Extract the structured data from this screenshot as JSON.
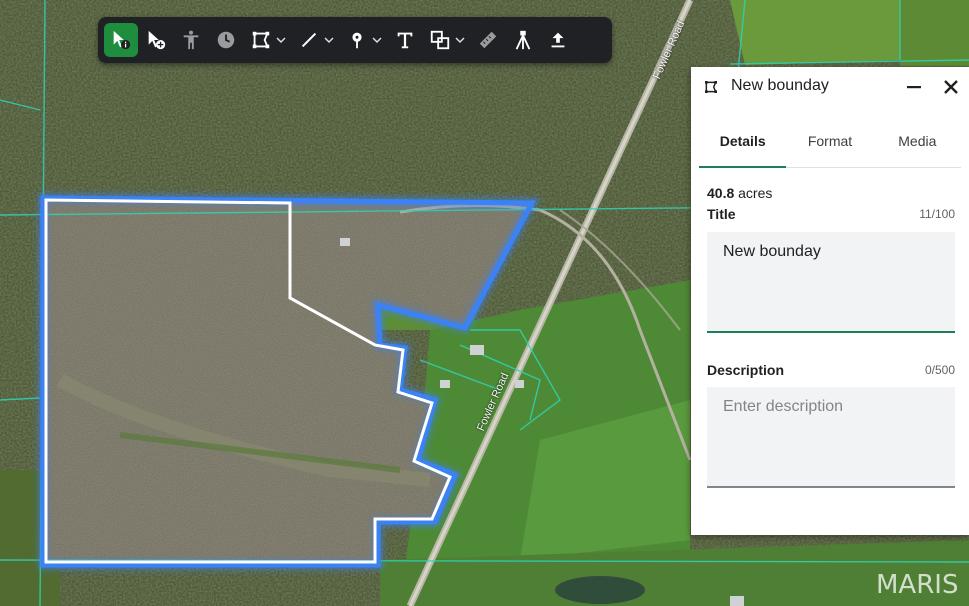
{
  "map": {
    "road_labels": [
      "Fowler Road",
      "Fowler Road"
    ],
    "watermark": "MARIS",
    "colors": {
      "boundary_outline": "#3b82f6",
      "boundary_inner": "#ffffff",
      "parcel_lines": "#2fd3b4"
    }
  },
  "toolbar": {
    "tools": [
      {
        "name": "select-tool",
        "icon": "cursor-info-icon",
        "active": true
      },
      {
        "name": "add-point-tool",
        "icon": "cursor-add-icon"
      },
      {
        "name": "street-view-tool",
        "icon": "pegman-icon"
      },
      {
        "name": "history-tool",
        "icon": "clock-icon"
      },
      {
        "name": "polygon-tool",
        "icon": "polygon-icon",
        "has_dropdown": true
      },
      {
        "name": "line-tool",
        "icon": "line-icon",
        "has_dropdown": true
      },
      {
        "name": "pin-tool",
        "icon": "pin-icon",
        "has_dropdown": true
      },
      {
        "name": "text-tool",
        "icon": "text-icon"
      },
      {
        "name": "shapes-tool",
        "icon": "shapes-icon",
        "has_dropdown": true
      },
      {
        "name": "measure-tool",
        "icon": "ruler-icon",
        "disabled": true
      },
      {
        "name": "survey-tool",
        "icon": "tripod-icon"
      },
      {
        "name": "export-tool",
        "icon": "upload-icon"
      }
    ]
  },
  "panel": {
    "title": "New bounday",
    "icon": "polygon-icon",
    "tabs": [
      {
        "label": "Details",
        "active": true
      },
      {
        "label": "Format"
      },
      {
        "label": "Media"
      }
    ],
    "acres_value": "40.8",
    "acres_unit": "acres",
    "title_label": "Title",
    "title_counter": "11/100",
    "title_value": "New bounday",
    "description_label": "Description",
    "description_counter": "0/500",
    "description_placeholder": "Enter description",
    "accent_color": "#1e7e5a"
  }
}
